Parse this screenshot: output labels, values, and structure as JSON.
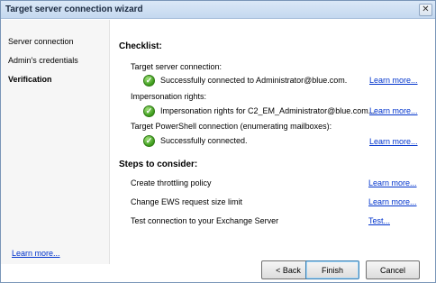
{
  "window": {
    "title": "Target server connection wizard",
    "close_glyph": "✕"
  },
  "sidebar": {
    "items": [
      {
        "label": "Server connection"
      },
      {
        "label": "Admin's credentials"
      },
      {
        "label": "Verification"
      }
    ],
    "learn_more": "Learn more..."
  },
  "checklist": {
    "title": "Checklist:",
    "items": [
      {
        "label": "Target server connection:",
        "status": "Successfully connected to Administrator@blue.com.",
        "link": "Learn more..."
      },
      {
        "label": "Impersonation rights:",
        "status": "Impersonation rights for C2_EM_Administrator@blue.com...",
        "link": "Learn more..."
      },
      {
        "label": "Target PowerShell connection (enumerating mailboxes):",
        "status": "Successfully connected.",
        "link": "Learn more..."
      }
    ]
  },
  "steps": {
    "title": "Steps to consider:",
    "items": [
      {
        "label": "Create throttling policy",
        "link": "Learn more..."
      },
      {
        "label": "Change EWS request size limit",
        "link": "Learn more..."
      },
      {
        "label": "Test connection to your Exchange Server",
        "link": "Test..."
      }
    ]
  },
  "buttons": {
    "back": "< Back",
    "finish": "Finish",
    "cancel": "Cancel"
  },
  "icons": {
    "check": "✓"
  }
}
